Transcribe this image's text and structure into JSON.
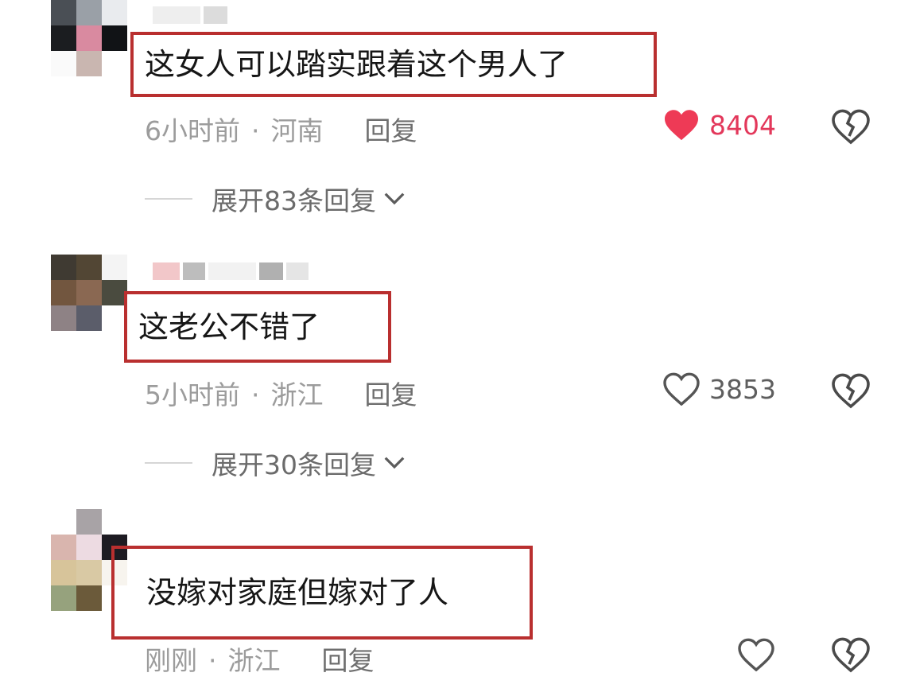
{
  "comments": [
    {
      "text": "这女人可以踏实跟着这个男人了",
      "time": "6小时前",
      "location": "河南",
      "reply_label": "回复",
      "likes": "8404",
      "liked": true,
      "expand_label": "展开83条回复"
    },
    {
      "text": "这老公不错了",
      "time": "5小时前",
      "location": "浙江",
      "reply_label": "回复",
      "likes": "3853",
      "liked": false,
      "expand_label": "展开30条回复"
    },
    {
      "text": "没嫁对家庭但嫁对了人",
      "time": "刚刚",
      "location": "浙江",
      "reply_label": "回复",
      "likes": "",
      "liked": false
    }
  ],
  "colors": {
    "highlight_box": "#b92f2f",
    "liked_heart": "#e3385b",
    "meta_text": "#9c9c9c"
  },
  "icons": [
    "heart-icon",
    "broken-heart-icon",
    "chevron-down-icon"
  ]
}
